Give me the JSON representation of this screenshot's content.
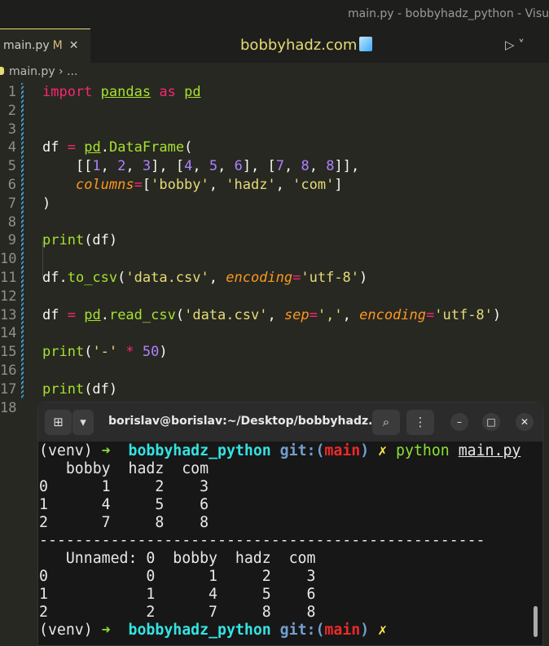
{
  "window": {
    "title": "main.py - bobbyhadz_python - Visu"
  },
  "tab": {
    "label": "main.py",
    "modified": "M",
    "close": "✕"
  },
  "brand": "bobbyhadz.com",
  "toolbar": {
    "run": "▷ ˅"
  },
  "breadcrumb": {
    "file": "main.py",
    "sep": " › ",
    "rest": "..."
  },
  "code": [
    [
      [
        "import",
        "kw"
      ],
      [
        " ",
        ""
      ],
      [
        "pandas",
        "mod"
      ],
      [
        " ",
        ""
      ],
      [
        "as",
        "kw"
      ],
      [
        " ",
        ""
      ],
      [
        "pd",
        "mod"
      ]
    ],
    [],
    [],
    [
      [
        "df ",
        ""
      ],
      [
        "=",
        "op"
      ],
      [
        " ",
        ""
      ],
      [
        "pd",
        "mod"
      ],
      [
        ".",
        ""
      ],
      [
        "DataFrame",
        "fn"
      ],
      [
        "(",
        ""
      ]
    ],
    [
      [
        "    [[",
        ""
      ],
      [
        "1",
        "num"
      ],
      [
        ", ",
        ""
      ],
      [
        "2",
        "num"
      ],
      [
        ", ",
        ""
      ],
      [
        "3",
        "num"
      ],
      [
        "], [",
        ""
      ],
      [
        "4",
        "num"
      ],
      [
        ", ",
        ""
      ],
      [
        "5",
        "num"
      ],
      [
        ", ",
        ""
      ],
      [
        "6",
        "num"
      ],
      [
        "], [",
        ""
      ],
      [
        "7",
        "num"
      ],
      [
        ", ",
        ""
      ],
      [
        "8",
        "num"
      ],
      [
        ", ",
        ""
      ],
      [
        "8",
        "num"
      ],
      [
        "]],",
        ""
      ]
    ],
    [
      [
        "    ",
        ""
      ],
      [
        "columns",
        "par"
      ],
      [
        "=",
        "op"
      ],
      [
        "[",
        ""
      ],
      [
        "'bobby'",
        "str"
      ],
      [
        ", ",
        ""
      ],
      [
        "'hadz'",
        "str"
      ],
      [
        ", ",
        ""
      ],
      [
        "'com'",
        "str"
      ],
      [
        "]",
        ""
      ]
    ],
    [
      [
        ")",
        ""
      ]
    ],
    [],
    [
      [
        "print",
        "fn"
      ],
      [
        "(df)",
        ""
      ]
    ],
    [],
    [
      [
        "df.",
        ""
      ],
      [
        "to_csv",
        "fn"
      ],
      [
        "(",
        ""
      ],
      [
        "'data.csv'",
        "str"
      ],
      [
        ", ",
        ""
      ],
      [
        "encoding",
        "par"
      ],
      [
        "=",
        "op"
      ],
      [
        "'utf-8'",
        "str"
      ],
      [
        ")",
        ""
      ]
    ],
    [],
    [
      [
        "df ",
        ""
      ],
      [
        "=",
        "op"
      ],
      [
        " ",
        ""
      ],
      [
        "pd",
        "mod"
      ],
      [
        ".",
        ""
      ],
      [
        "read_csv",
        "fn"
      ],
      [
        "(",
        ""
      ],
      [
        "'data.csv'",
        "str"
      ],
      [
        ", ",
        ""
      ],
      [
        "sep",
        "par"
      ],
      [
        "=",
        "op"
      ],
      [
        "','",
        "str"
      ],
      [
        ", ",
        ""
      ],
      [
        "encoding",
        "par"
      ],
      [
        "=",
        "op"
      ],
      [
        "'utf-8'",
        "str"
      ],
      [
        ")",
        ""
      ]
    ],
    [],
    [
      [
        "print",
        "fn"
      ],
      [
        "(",
        ""
      ],
      [
        "'-'",
        "str"
      ],
      [
        " ",
        ""
      ],
      [
        "*",
        "op"
      ],
      [
        " ",
        ""
      ],
      [
        "50",
        "num"
      ],
      [
        ")",
        ""
      ]
    ],
    [],
    [
      [
        "print",
        "fn"
      ],
      [
        "(df)",
        ""
      ]
    ],
    []
  ],
  "terminal": {
    "title": "borislav@borislav:~/Desktop/bobbyhadz...",
    "buttons": {
      "new_tab": "⊞",
      "dropdown": "▾",
      "search": "⌕",
      "menu": "⋮",
      "minimize": "–",
      "maximize": "□",
      "close": "✕"
    },
    "lines": [
      [
        [
          "(venv) ",
          ""
        ],
        [
          "➜",
          "g"
        ],
        [
          "  ",
          ""
        ],
        [
          "bobbyhadz_python",
          "c"
        ],
        [
          " ",
          ""
        ],
        [
          "git:(",
          "b"
        ],
        [
          "main",
          "r"
        ],
        [
          ")",
          "b"
        ],
        [
          " ",
          ""
        ],
        [
          "✗",
          "y"
        ],
        [
          " ",
          ""
        ],
        [
          "python",
          "cmd"
        ],
        [
          " ",
          ""
        ],
        [
          "main.py",
          "u"
        ]
      ],
      [
        [
          "   bobby  hadz  com",
          ""
        ]
      ],
      [
        [
          "0      1     2    3",
          ""
        ]
      ],
      [
        [
          "1      4     5    6",
          ""
        ]
      ],
      [
        [
          "2      7     8    8",
          ""
        ]
      ],
      [
        [
          "--------------------------------------------------",
          ""
        ]
      ],
      [
        [
          "   Unnamed: 0  bobby  hadz  com",
          ""
        ]
      ],
      [
        [
          "0           0      1     2    3",
          ""
        ]
      ],
      [
        [
          "1           1      4     5    6",
          ""
        ]
      ],
      [
        [
          "2           2      7     8    8",
          ""
        ]
      ],
      [
        [
          "(venv) ",
          ""
        ],
        [
          "➜",
          "g"
        ],
        [
          "  ",
          ""
        ],
        [
          "bobbyhadz_python",
          "c"
        ],
        [
          " ",
          ""
        ],
        [
          "git:(",
          "b"
        ],
        [
          "main",
          "r"
        ],
        [
          ")",
          "b"
        ],
        [
          " ",
          ""
        ],
        [
          "✗",
          "y"
        ]
      ]
    ]
  }
}
